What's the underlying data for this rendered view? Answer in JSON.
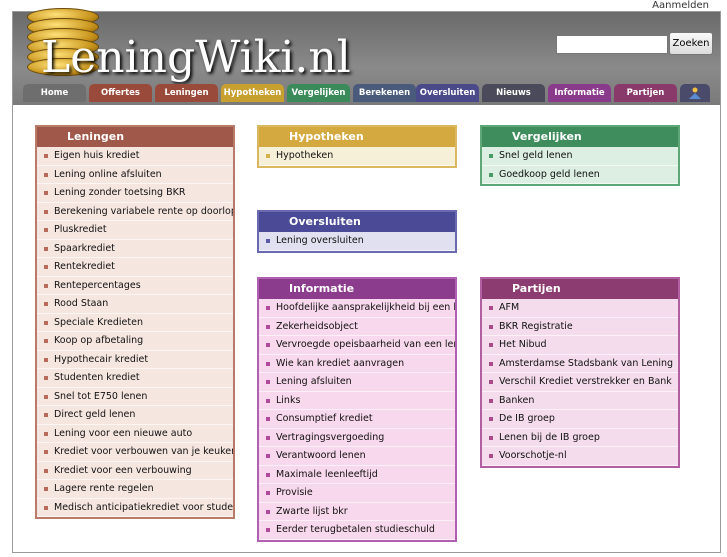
{
  "top": {
    "login": "Aanmelden"
  },
  "header": {
    "logo": "LeningWiki.nl",
    "search_placeholder": "",
    "search_button": "Zoeken"
  },
  "nav": {
    "tabs": [
      {
        "label": "Home",
        "color": "#6e6e6e"
      },
      {
        "label": "Offertes",
        "color": "#9a4a3a"
      },
      {
        "label": "Leningen",
        "color": "#9a4a3a"
      },
      {
        "label": "Hypotheken",
        "color": "#c8a030"
      },
      {
        "label": "Vergelijken",
        "color": "#3a8a5a"
      },
      {
        "label": "Berekenen",
        "color": "#4a5a7a"
      },
      {
        "label": "Oversluiten",
        "color": "#4a4a8a"
      },
      {
        "label": "Nieuws",
        "color": "#4a4a5a"
      },
      {
        "label": "Informatie",
        "color": "#8a3a8a"
      },
      {
        "label": "Partijen",
        "color": "#8a3a6a"
      }
    ]
  },
  "boxes": {
    "leningen": {
      "title": "Leningen",
      "header_color": "#a0584a",
      "border_color": "#b97a6a",
      "item_bg": "#f6e6e0",
      "bullet": "#b86a5a",
      "items": [
        "Eigen huis krediet",
        "Lening online afsluiten",
        "Lening zonder toetsing BKR",
        "Berekening variabele rente op doorlopend",
        "Pluskrediet",
        "Spaarkrediet",
        "Rentekrediet",
        "Rentepercentages",
        "Rood Staan",
        "Speciale Kredieten",
        "Koop op afbetaling",
        "Hypothecair krediet",
        "Studenten krediet",
        "Snel tot E750 lenen",
        "Direct geld lenen",
        "Lening voor een nieuwe auto",
        "Krediet voor verbouwen van je keuken",
        "Krediet voor een verbouwing",
        "Lagere rente regelen",
        "Medisch anticipatiekrediet voor studenter"
      ]
    },
    "hypotheken": {
      "title": "Hypotheken",
      "header_color": "#d4aa40",
      "border_color": "#d9b860",
      "item_bg": "#f7f0d8",
      "bullet": "#d6b24a",
      "items": [
        "Hypotheken"
      ]
    },
    "vergelijken": {
      "title": "Vergelijken",
      "header_color": "#3f8c5c",
      "border_color": "#5ea878",
      "item_bg": "#dcefe2",
      "bullet": "#4a9a68",
      "items": [
        "Snel geld lenen",
        "Goedkoop geld lenen"
      ]
    },
    "oversluiten": {
      "title": "Oversluiten",
      "header_color": "#4a4a96",
      "border_color": "#6a6ab0",
      "item_bg": "#e0e0f0",
      "bullet": "#5a5aa8",
      "items": [
        "Lening oversluiten"
      ]
    },
    "informatie": {
      "title": "Informatie",
      "header_color": "#8c3c8c",
      "border_color": "#b060b0",
      "item_bg": "#f8d8ec",
      "bullet": "#b04a9a",
      "items": [
        "Hoofdelijke aansprakelijkheid bij een lenir",
        "Zekerheidsobject",
        "Vervroegde opeisbaarheid van een lening",
        "Wie kan krediet aanvragen",
        "Lening afsluiten",
        "Links",
        "Consumptief krediet",
        "Vertragingsvergoeding",
        "Verantwoord lenen",
        "Maximale leenleeftijd",
        "Provisie",
        "Zwarte lijst bkr",
        "Eerder terugbetalen studieschuld"
      ]
    },
    "partijen": {
      "title": "Partijen",
      "header_color": "#8c3c70",
      "border_color": "#b060a0",
      "item_bg": "#f4dcec",
      "bullet": "#a84a88",
      "items": [
        "AFM",
        "BKR Registratie",
        "Het Nibud",
        "Amsterdamse Stadsbank van Lening",
        "Verschil Krediet verstrekker en Bank",
        "Banken",
        "De IB groep",
        "Lenen bij de IB groep",
        "Voorschotje-nl"
      ]
    }
  }
}
